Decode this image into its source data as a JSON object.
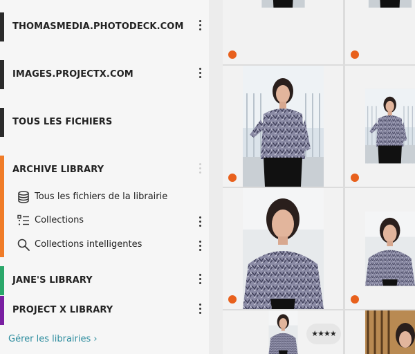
{
  "colors": {
    "accent_teal": "#2c8c9e",
    "archive_library": "#f07c28",
    "janes_library": "#2aa76a",
    "project_x_library": "#7a1fa2",
    "dark_bar": "#2b2b2b",
    "flag_dot": "#e8601c"
  },
  "sidebar": {
    "libraries": [
      {
        "label": "THOMASMEDIA.PHOTODECK.COM"
      },
      {
        "label": "IMAGES.PROJECTX.COM"
      },
      {
        "label": "TOUS LES FICHIERS"
      },
      {
        "label": "ARCHIVE LIBRARY",
        "items": [
          {
            "label": "Tous les fichiers de la librairie",
            "icon": "database-icon"
          },
          {
            "label": "Collections",
            "icon": "list-icon"
          },
          {
            "label": "Collections intelligentes",
            "icon": "search-icon"
          }
        ]
      },
      {
        "label": "JANE'S LIBRARY"
      },
      {
        "label": "PROJECT X LIBRARY"
      }
    ],
    "manage_link": "Gérer les librairies ›"
  },
  "grid": {
    "rating_badge": "★★★★",
    "tiles": 8
  }
}
